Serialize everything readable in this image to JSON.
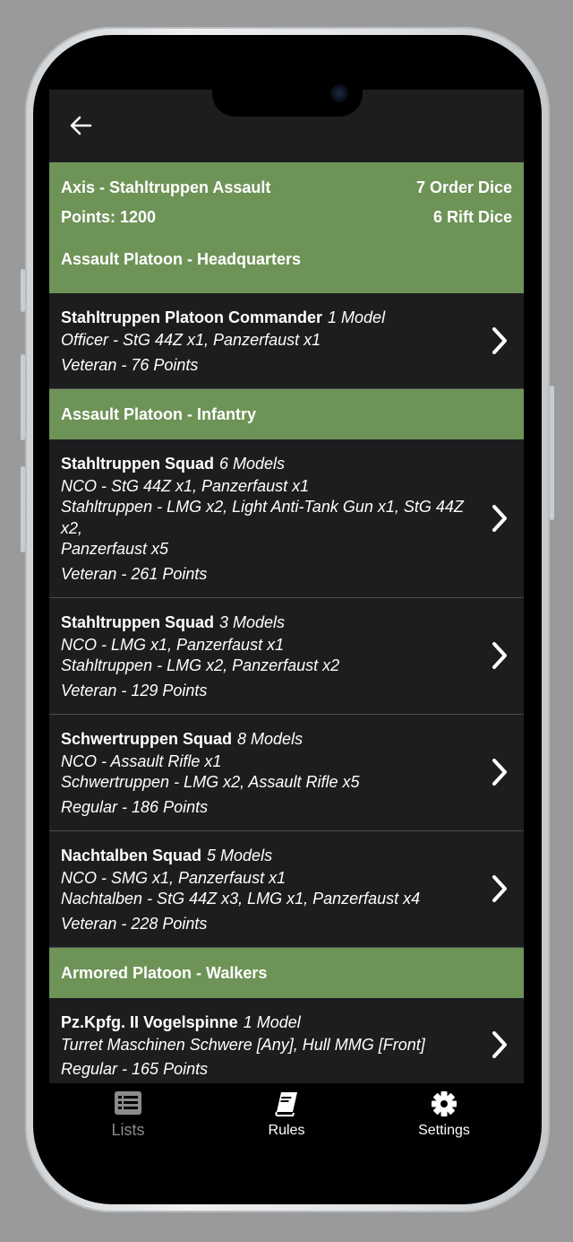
{
  "header": {
    "back_icon": "arrow-left-icon"
  },
  "army": {
    "faction": "Axis -  Stahltruppen Assault",
    "order_dice": "7 Order Dice",
    "points": "Points: 1200",
    "rift_dice": "6 Rift Dice"
  },
  "sections": [
    {
      "title": "Assault Platoon - Headquarters",
      "units": [
        {
          "name": "Stahltruppen Platoon Commander",
          "models": "1 Model",
          "lines": [
            "Officer - StG 44Z x1, Panzerfaust x1"
          ],
          "points": "Veteran - 76 Points"
        }
      ]
    },
    {
      "title": "Assault Platoon - Infantry",
      "units": [
        {
          "name": "Stahltruppen Squad",
          "models": "6 Models",
          "lines": [
            "NCO - StG 44Z x1, Panzerfaust x1",
            "Stahltruppen - LMG x2, Light Anti-Tank Gun x1, StG 44Z x2,",
            "Panzerfaust x5"
          ],
          "points": "Veteran - 261 Points"
        },
        {
          "name": "Stahltruppen Squad",
          "models": "3 Models",
          "lines": [
            "NCO - LMG x1, Panzerfaust x1",
            "Stahltruppen - LMG x2, Panzerfaust x2"
          ],
          "points": "Veteran - 129 Points"
        },
        {
          "name": "Schwertruppen Squad",
          "models": "8 Models",
          "lines": [
            "NCO - Assault Rifle x1",
            "Schwertruppen - LMG x2, Assault Rifle x5"
          ],
          "points": "Regular - 186 Points"
        },
        {
          "name": "Nachtalben Squad",
          "models": "5 Models",
          "lines": [
            "NCO - SMG x1, Panzerfaust x1",
            "Nachtalben - StG 44Z x3, LMG x1, Panzerfaust x4"
          ],
          "points": "Veteran - 228 Points"
        }
      ]
    },
    {
      "title": "Armored Platoon - Walkers",
      "units": [
        {
          "name": "Pz.Kpfg. II Vogelspinne",
          "models": "1 Model",
          "lines": [
            "Turret Maschinen Schwere [Any], Hull MMG [Front]"
          ],
          "points": "Regular - 165 Points"
        }
      ]
    }
  ],
  "tabs": [
    {
      "label": "Lists",
      "icon": "list-icon",
      "active": false
    },
    {
      "label": "Rules",
      "icon": "book-icon",
      "active": true
    },
    {
      "label": "Settings",
      "icon": "gear-icon",
      "active": true
    }
  ]
}
